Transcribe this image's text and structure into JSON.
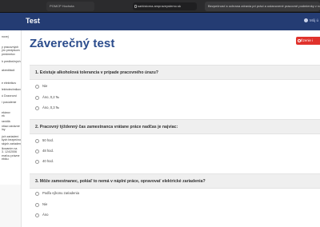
{
  "browser": {
    "tab_left": "PGMCP Hochota",
    "url": "sarkistoma.ampraveystemo.sk",
    "tab_right": "Bezpečnosť a ochrana zdravia pri práci a ustanovené pracovné podmienky v rozsahu 8.1 Výchova a vzdelávanie zamestnancov"
  },
  "header": {
    "brand": "Test",
    "user_label": "Môj ú"
  },
  "sidebar": {
    "items": [
      [
        "novej"
      ],
      [
        "y pracovných",
        "ým predpisom",
        "predmetov"
      ],
      [
        "h predbežných"
      ],
      [
        "akreditácii"
      ],
      [
        "e elektrikov"
      ],
      [
        "lektrotechnikov"
      ],
      [
        "ú Dozorcovi"
      ],
      [
        "i posúdenie"
      ],
      [
        "ekárov",
        "ek"
      ],
      [
        "ravidlá"
      ],
      [
        "ntiaci záväzné",
        "iny"
      ],
      [
        "ých zariadení",
        "kych bezpečnostných",
        "ských zariadení"
      ],
      [
        "lkovaním na",
        "3. 124/2006",
        "eraťou právne",
        "ebiku"
      ]
    ]
  },
  "main": {
    "title": "Záverečný test",
    "end_button": "Ězenie i",
    "questions": [
      {
        "text": "1. Existuje alkoholová tolerancia v prípade pracovného úrazu?",
        "options": [
          "Nie",
          "Áno, 0,2 ‰",
          "Áno, 0,3 ‰"
        ]
      },
      {
        "text": "2. Pracovný týždenný čas zamestnanca vrátane práce nadčas je najviac:",
        "options": [
          "50 hod.",
          "48 hod.",
          "40 hod."
        ]
      },
      {
        "text": "3. Môže zamestnanec, pokiaľ to nemá v náplni práce, opravovať elektrické zariadenia?",
        "options": [
          "Podľa výkonu zariadenia",
          "Nie",
          "Áno"
        ]
      }
    ]
  },
  "colors": {
    "header_bg": "#243c73",
    "title": "#2b4c8c",
    "end_button_bg": "#e0322c"
  }
}
